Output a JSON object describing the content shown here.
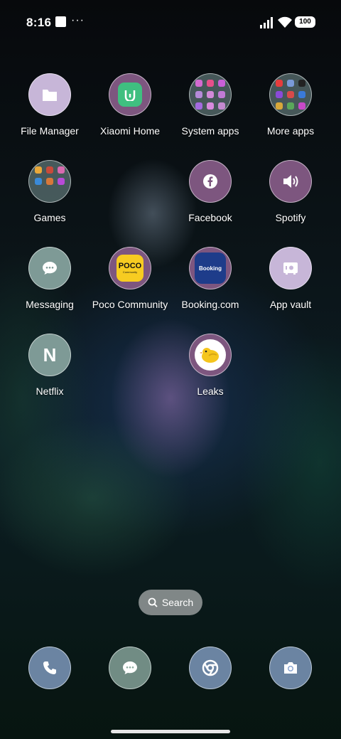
{
  "status_bar": {
    "time": "8:16",
    "overflow_dots": "···",
    "battery": "100"
  },
  "apps": {
    "file_manager": "File Manager",
    "xiaomi_home": "Xiaomi Home",
    "system_apps": "System apps",
    "more_apps": "More apps",
    "games": "Games",
    "facebook": "Facebook",
    "spotify": "Spotify",
    "messaging": "Messaging",
    "poco_community": "Poco Community",
    "booking": "Booking.com",
    "app_vault": "App vault",
    "netflix": "Netflix",
    "leaks": "Leaks"
  },
  "icons": {
    "poco_text": "POCO",
    "poco_sub": "Community",
    "booking_text": "Booking",
    "netflix_letter": "N"
  },
  "search": {
    "label": "Search"
  },
  "dock": [
    "phone-icon",
    "messages-icon",
    "chrome-icon",
    "camera-icon"
  ],
  "colors": {
    "lavender_icon": "#c7b6d8",
    "purple_icon": "#7d567f",
    "poco_yellow": "#f7cc21",
    "booking_blue": "#1e3c8a"
  }
}
